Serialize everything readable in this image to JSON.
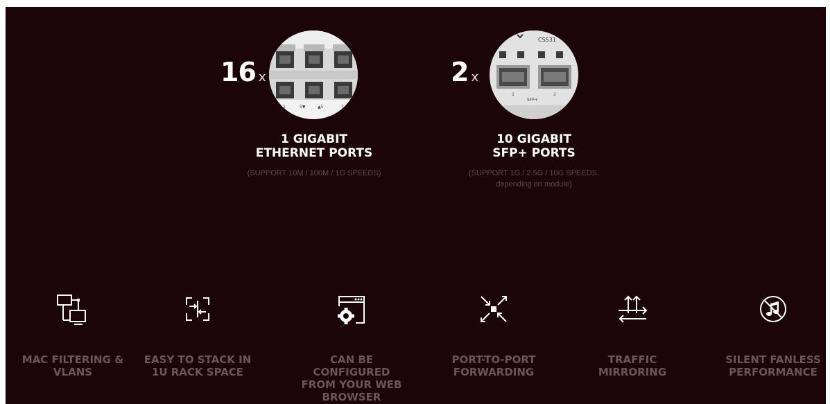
{
  "ports": [
    {
      "count": "16",
      "multiplier": "x",
      "title_line1": "1 GIGABIT",
      "title_line2": "ETHERNET PORTS",
      "subtitle_line1": "(SUPPORT 10M / 100M / 1G SPEEDS)",
      "subtitle_line2": "",
      "photo_labels": [
        "1",
        "5▼",
        "▲5",
        "7"
      ]
    },
    {
      "count": "2",
      "multiplier": "x",
      "title_line1": "10 GIGABIT",
      "title_line2": "SFP+ PORTS",
      "subtitle_line1": "(SUPPORT 1G / 2.5G / 10G SPEEDS,",
      "subtitle_line2": "depending on module)",
      "photo_labels": [
        "CSS31",
        "SFP+",
        "1",
        "2"
      ]
    }
  ],
  "features": [
    {
      "icon": "network-screens-icon",
      "line1": "MAC FILTERING &",
      "line2": "VLANS",
      "line3": ""
    },
    {
      "icon": "rack-stack-icon",
      "line1": "EASY TO STACK IN",
      "line2": "1U RACK SPACE",
      "line3": ""
    },
    {
      "icon": "browser-gear-icon",
      "line1": "CAN BE CONFIGURED",
      "line2": "FROM YOUR WEB",
      "line3": "BROWSER"
    },
    {
      "icon": "port-forwarding-icon",
      "line1": "PORT-TO-PORT",
      "line2": "FORWARDING",
      "line3": ""
    },
    {
      "icon": "traffic-mirror-icon",
      "line1": "TRAFFIC MIRRORING",
      "line2": "",
      "line3": ""
    },
    {
      "icon": "silent-music-icon",
      "line1": "SILENT FANLESS",
      "line2": "PERFORMANCE",
      "line3": ""
    }
  ],
  "colors": {
    "background": "#1b0509",
    "title": "#ffffff",
    "subtitle": "#5f4a4f",
    "feature_label": "#6b555a"
  }
}
